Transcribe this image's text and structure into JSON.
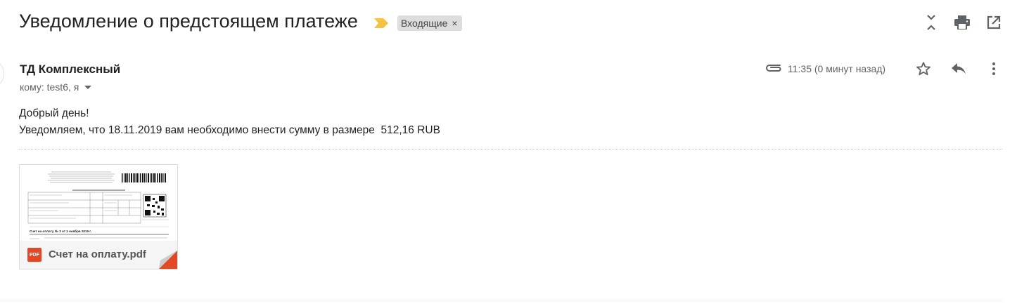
{
  "message": {
    "subject": "Уведомление о предстоящем платеже",
    "label": "Входящие",
    "label_remove": "×",
    "sender": "ТД Комплексный",
    "recipients": "кому: test6, я",
    "time": "11:35 (0 минут назад)",
    "body_lines": [
      "Добрый день!",
      "Уведомляем, что 18.11.2019 вам необходимо внести сумму в размере  512,16 RUB"
    ]
  },
  "attachment": {
    "filename": "Счет на оплату.pdf",
    "badge": "PDF",
    "preview_title": "Счет на оплату № 3 от 1 ноября 2019 г."
  },
  "toolbar": {
    "icons": [
      "collapse-all-icon",
      "print-icon",
      "open-in-new-window-icon"
    ]
  },
  "header_icons": [
    "paperclip-icon",
    "star-icon",
    "reply-icon",
    "more-vert-icon"
  ],
  "colors": {
    "important_marker": "#f5c342",
    "label_chip_bg": "#dddddd",
    "pdf_red": "#e34724",
    "icon_gray": "#5f6368"
  }
}
